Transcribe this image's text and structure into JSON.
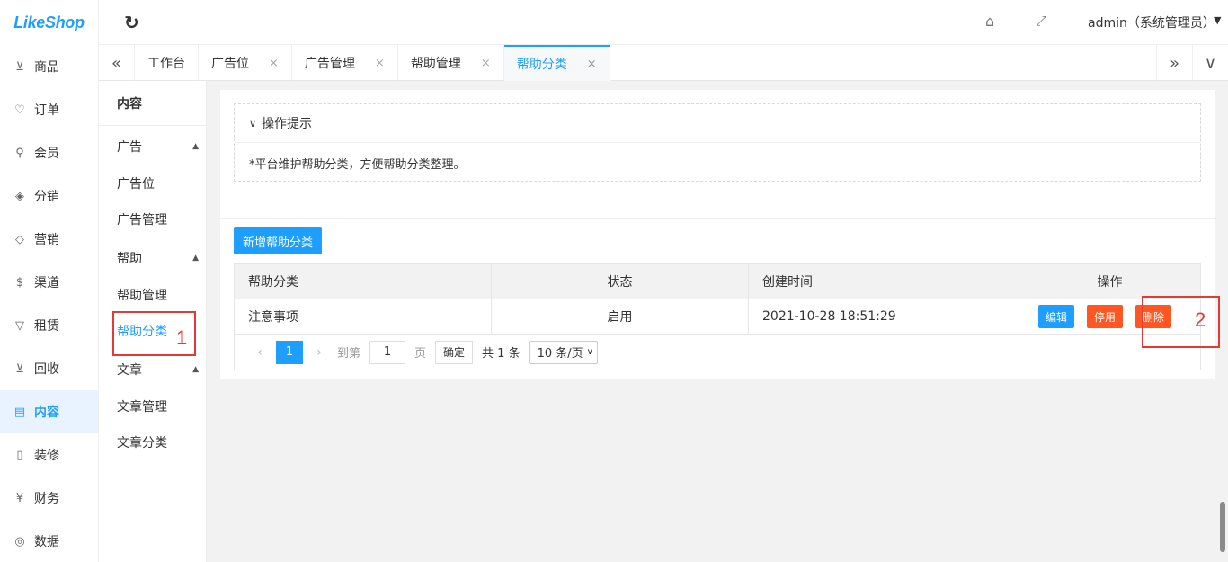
{
  "app": {
    "logo_text": "LikeShop"
  },
  "left_nav": [
    {
      "key": "goods",
      "icon": "cart-icon",
      "glyph": "⊻",
      "label": "商品"
    },
    {
      "key": "order",
      "icon": "bell-icon",
      "glyph": "♡",
      "label": "订单"
    },
    {
      "key": "member",
      "icon": "user-icon",
      "glyph": "♀",
      "label": "会员"
    },
    {
      "key": "distribution",
      "icon": "layers-icon",
      "glyph": "◈",
      "label": "分销"
    },
    {
      "key": "marketing",
      "icon": "diamond-icon",
      "glyph": "◇",
      "label": "营销"
    },
    {
      "key": "channel",
      "icon": "dollar-icon",
      "glyph": "$",
      "label": "渠道"
    },
    {
      "key": "lease",
      "icon": "shield-icon",
      "glyph": "▽",
      "label": "租赁"
    },
    {
      "key": "recycle",
      "icon": "cart-icon",
      "glyph": "⊻",
      "label": "回收"
    },
    {
      "key": "content",
      "icon": "book-icon",
      "glyph": "▤",
      "label": "内容"
    },
    {
      "key": "decorate",
      "icon": "tablet-icon",
      "glyph": "▯",
      "label": "装修"
    },
    {
      "key": "finance",
      "icon": "yen-icon",
      "glyph": "¥",
      "label": "财务"
    },
    {
      "key": "data",
      "icon": "globe-icon",
      "glyph": "◎",
      "label": "数据"
    }
  ],
  "header": {
    "user_label": "admin（系统管理员）"
  },
  "tabs": [
    {
      "label": "工作台",
      "closable": false
    },
    {
      "label": "广告位",
      "closable": true
    },
    {
      "label": "广告管理",
      "closable": true
    },
    {
      "label": "帮助管理",
      "closable": true
    },
    {
      "label": "帮助分类",
      "closable": true,
      "active": true
    }
  ],
  "sub_nav": {
    "title": "内容",
    "groups": [
      {
        "label": "广告",
        "items": [
          "广告位",
          "广告管理"
        ]
      },
      {
        "label": "帮助",
        "items": [
          "帮助管理",
          "帮助分类"
        ]
      },
      {
        "label": "文章",
        "items": [
          "文章管理",
          "文章分类"
        ]
      }
    ],
    "active_item": "帮助分类"
  },
  "tips": {
    "title": "操作提示",
    "text": "*平台维护帮助分类，方便帮助分类整理。"
  },
  "toolbar": {
    "add_label": "新增帮助分类"
  },
  "table": {
    "headers": [
      "帮助分类",
      "状态",
      "创建时间",
      "操作"
    ],
    "rows": [
      {
        "name": "注意事项",
        "status": "启用",
        "created": "2021-10-28 18:51:29"
      }
    ],
    "actions": {
      "edit": "编辑",
      "disable": "停用",
      "delete": "删除"
    }
  },
  "pager": {
    "current": "1",
    "goto_label": "到第",
    "goto_value": "1",
    "page_unit": "页",
    "confirm": "确定",
    "total": "共 1 条",
    "page_size": "10 条/页"
  },
  "annotations": [
    "1",
    "2"
  ],
  "colors": {
    "accent": "#1e9fff",
    "danger": "#ff5722",
    "annotation": "#e53935"
  }
}
